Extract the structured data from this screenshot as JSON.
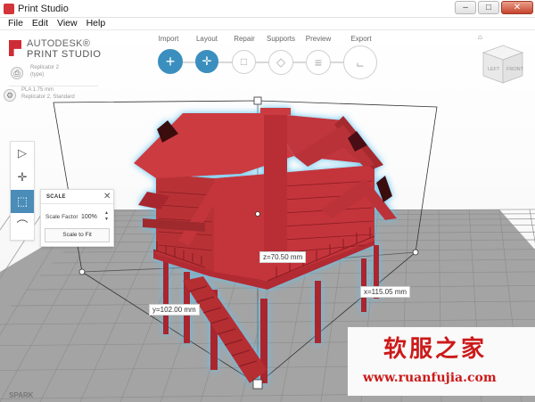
{
  "window": {
    "title": "Print Studio",
    "min_glyph": "–",
    "max_glyph": "□",
    "close_glyph": "✕"
  },
  "menu": [
    "File",
    "Edit",
    "View",
    "Help"
  ],
  "brand": {
    "line1": "AUTODESK®",
    "line2": "PRINT STUDIO"
  },
  "printer": {
    "name": "Replicator 2",
    "type": "(type)"
  },
  "material": {
    "name": "PLA 1.75 mm",
    "profile": "Replicator 2, Standard"
  },
  "workflow": [
    {
      "label": "Import",
      "icon": "plus-icon",
      "glyph": "+",
      "active": true
    },
    {
      "label": "Layout",
      "icon": "move-icon",
      "glyph": "✛",
      "active": true
    },
    {
      "label": "Repair",
      "icon": "document-icon",
      "glyph": "□",
      "active": false
    },
    {
      "label": "Supports",
      "icon": "supports-icon",
      "glyph": "◇",
      "active": false
    },
    {
      "label": "Preview",
      "icon": "layers-icon",
      "glyph": "≡",
      "active": false
    },
    {
      "label": "Export",
      "icon": "export-icon",
      "glyph": "⨽",
      "active": false
    }
  ],
  "viewcube": {
    "left": "LEFT",
    "front": "FRONT"
  },
  "toolbar": [
    {
      "name": "select-tool",
      "icon": "pointer-icon",
      "glyph": "▷",
      "active": false
    },
    {
      "name": "move-tool",
      "icon": "move-icon",
      "glyph": "✛",
      "active": false
    },
    {
      "name": "scale-tool",
      "icon": "scale-icon",
      "glyph": "⬚",
      "active": true
    },
    {
      "name": "lay-flat-tool",
      "icon": "lay-flat-icon",
      "glyph": "⌒",
      "active": false
    }
  ],
  "scale_panel": {
    "title": "SCALE",
    "close": "✕",
    "factor_label": "Scale Factor",
    "factor_value": "100%",
    "up": "▲",
    "down": "▼",
    "fit_label": "Scale to Fit"
  },
  "dimensions": {
    "x": "x=115.05 mm",
    "y": "y=102.00 mm",
    "z": "z=70.50 mm"
  },
  "footer": {
    "spark": "SPARK"
  },
  "watermark": {
    "cn": "软服之家",
    "url": "www.ruanfujia.com"
  },
  "colors": {
    "model": "#bf3036",
    "accent": "#3b8fbf",
    "grid": "#8c8c8c",
    "glow": "#5ec3f0"
  }
}
